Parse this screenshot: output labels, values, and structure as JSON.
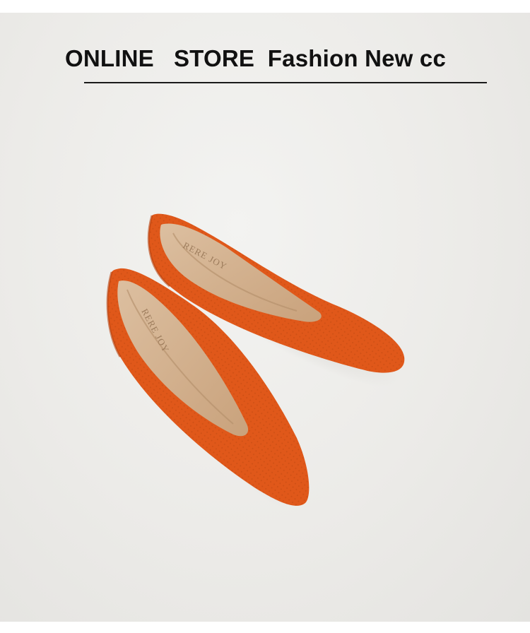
{
  "header": {
    "title": "ONLINE   STORE  Fashion New cc"
  },
  "product": {
    "insole_brand_text": "RERE JOY",
    "colors": {
      "knit": "#e0581a",
      "knit_shadow": "#b8410e",
      "insole": "#d6b595",
      "lining": "#c9a883",
      "background": "#ecebe8"
    }
  }
}
